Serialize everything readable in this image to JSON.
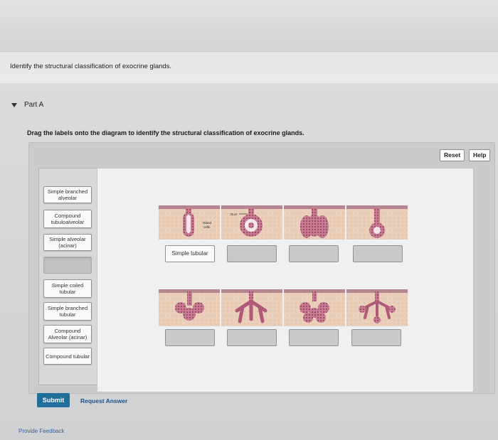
{
  "intro": {
    "text": "Identify the structural classification of exocrine glands."
  },
  "part": {
    "label": "Part A"
  },
  "instruction": "Drag the labels onto the diagram to identify the structural classification of exocrine glands.",
  "toolbar": {
    "reset_label": "Reset",
    "help_label": "Help"
  },
  "label_bank": [
    "Simple branched\nalveolar",
    "Compound\ntubuloalveolar",
    "Simple alveolar\n(acinar)",
    "",
    "Simple coiled\ntubular",
    "Simple branched\ntubular",
    "Compound\nAlveolar (acinar)",
    "Compound tubular"
  ],
  "diagram": {
    "annotations": {
      "duct": "Duct",
      "gland_cells": "Gland\ncells"
    },
    "drop_targets_row1": [
      "Simple tubular",
      "",
      "",
      ""
    ],
    "drop_targets_row2": [
      "",
      "",
      "",
      ""
    ]
  },
  "actions": {
    "submit_label": "Submit",
    "request_answer_label": "Request Answer",
    "feedback_label": "Provide Feedback"
  },
  "colors": {
    "submit_bg": "#1f6e9c",
    "gland_pink": "#c25b7a",
    "tissue_tan": "#e8c9b0"
  }
}
